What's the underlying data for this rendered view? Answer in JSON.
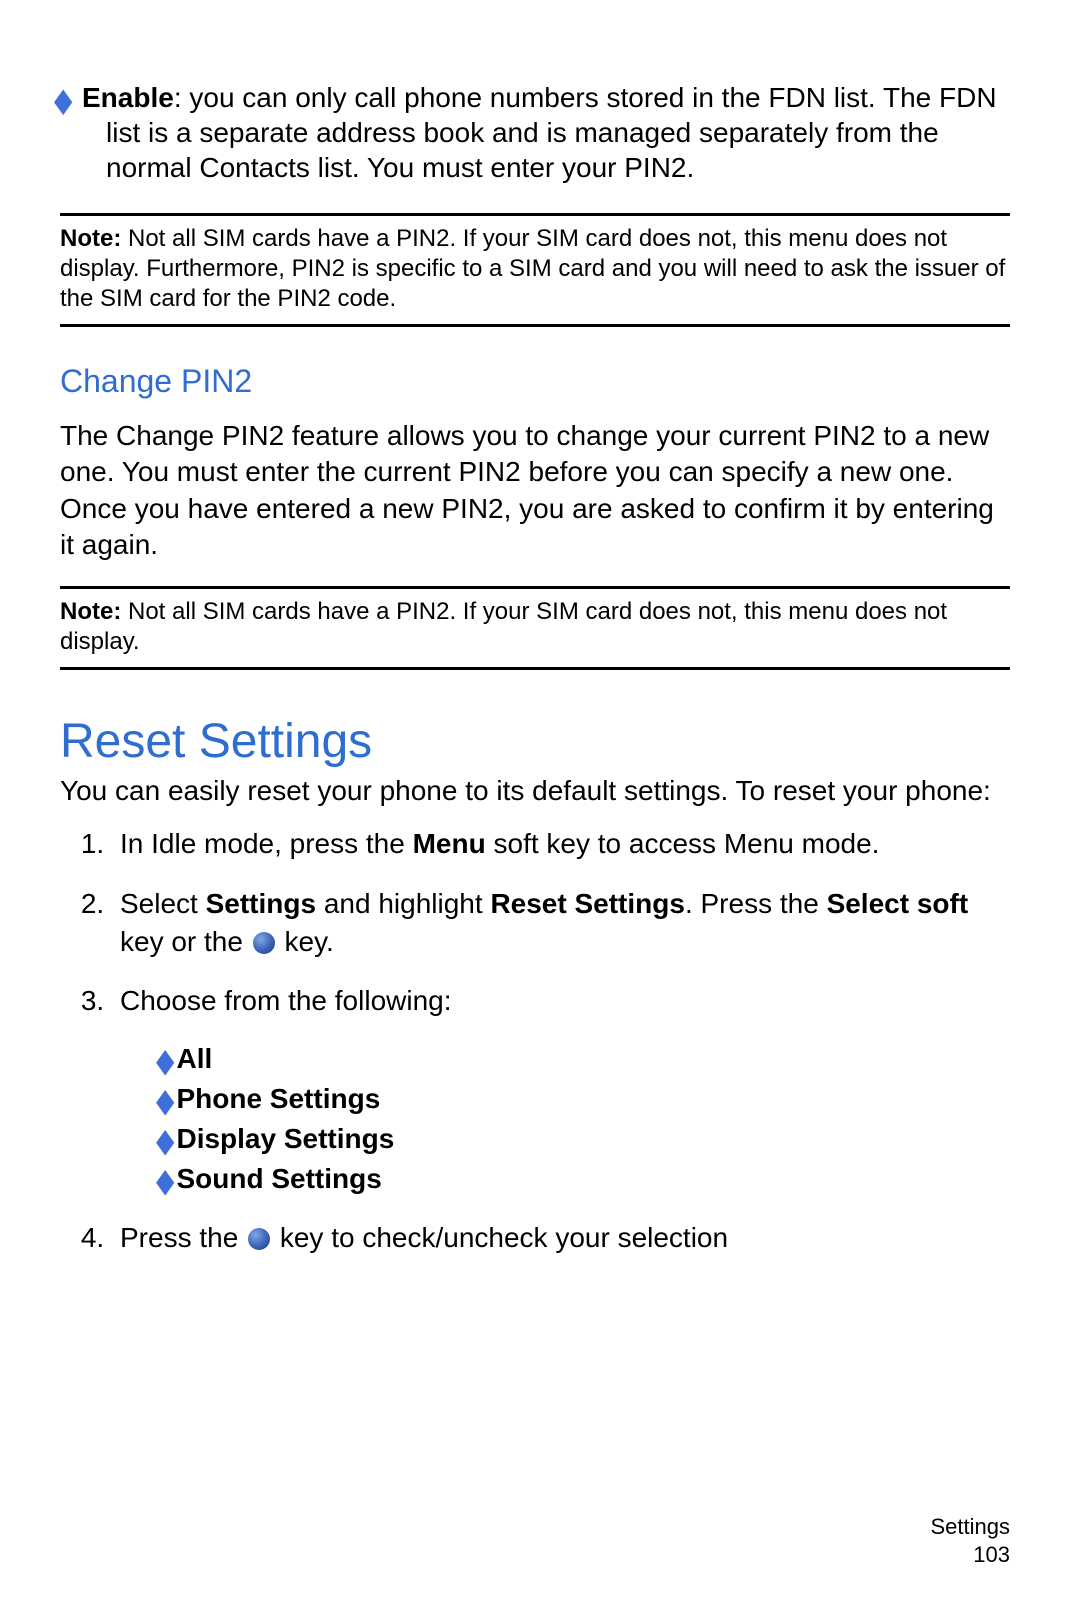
{
  "enable": {
    "label": "Enable",
    "text": ": you can only call phone numbers stored in the FDN list. The FDN list is a separate address book and is managed separately from the normal Contacts list. You must enter your PIN2."
  },
  "note1": {
    "label": "Note:",
    "text": " Not all SIM cards have a PIN2. If your SIM card does not, this menu does not display. Furthermore, PIN2 is specific to a SIM card and you will need to ask the issuer of the SIM card for the PIN2 code."
  },
  "changePin2": {
    "heading": "Change PIN2",
    "para": "The Change PIN2 feature allows you to change your current PIN2 to a new one. You must enter the current PIN2 before you can specify a new one. Once you have entered a new PIN2, you are asked to confirm it by entering it again."
  },
  "note2": {
    "label": "Note:",
    "text": " Not all SIM cards have a PIN2. If your SIM card does not, this menu does not display."
  },
  "reset": {
    "heading": "Reset Settings",
    "intro": "You can easily reset your phone to its default settings. To reset your phone:"
  },
  "steps": {
    "s1_a": "In Idle mode, press the ",
    "s1_b": "Menu",
    "s1_c": " soft key to access Menu mode.",
    "s2_a": "Select ",
    "s2_b": "Settings",
    "s2_c": " and highlight ",
    "s2_d": "Reset Settings",
    "s2_e": ". Press the ",
    "s2_f": "Select soft",
    "s2_g": " key or the ",
    "s2_h": " key.",
    "s3": "Choose from the following:",
    "s4_a": "Press the ",
    "s4_b": " key to check/uncheck your selection"
  },
  "options": [
    "All",
    "Phone Settings",
    "Display Settings",
    "Sound Settings"
  ],
  "footer": {
    "section": "Settings",
    "page": "103"
  }
}
